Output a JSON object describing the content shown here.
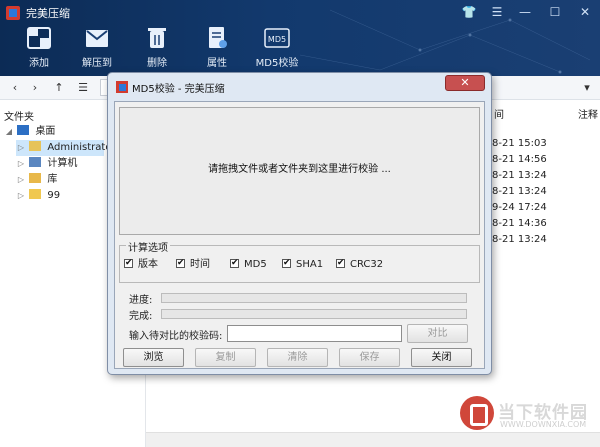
{
  "app": {
    "title": "完美压缩"
  },
  "window_controls": {
    "skin": "👕",
    "menu": "☰",
    "minimize": "—",
    "maximize": "☐",
    "close": "✕"
  },
  "toolbar": {
    "items": [
      {
        "label": "添加",
        "icon": "add-icon"
      },
      {
        "label": "解压到",
        "icon": "extract-icon"
      },
      {
        "label": "删除",
        "icon": "trash-icon"
      },
      {
        "label": "属性",
        "icon": "properties-icon"
      },
      {
        "label": "MD5校验",
        "icon": "md5-icon",
        "icon_text": "MD5"
      }
    ]
  },
  "nav": {
    "back": "‹",
    "forward": "›",
    "up": "↑",
    "list": "☰"
  },
  "tree": {
    "header": "文件夹",
    "items": [
      {
        "label": "桌面",
        "expanded": true
      },
      {
        "label": "Administrator",
        "selected": true
      },
      {
        "label": "计算机"
      },
      {
        "label": "库"
      },
      {
        "label": "99"
      }
    ]
  },
  "list": {
    "headers": {
      "modified": "间",
      "note": "注释"
    },
    "dates": [
      "8-21 15:03",
      "8-21 14:56",
      "8-21 13:24",
      "8-21 13:24",
      "9-24 17:24",
      "8-21 14:36",
      "8-21 13:24"
    ]
  },
  "watermark": {
    "text": "当下软件园",
    "url": "WWW.DOWNXIA.COM"
  },
  "dialog": {
    "title": "MD5校验 - 完美压缩",
    "close": "✕",
    "drop_message": "请拖拽文件或者文件夹到这里进行校验 ...",
    "options_title": "计算选项",
    "options": [
      {
        "label": "版本",
        "checked": true
      },
      {
        "label": "时间",
        "checked": true
      },
      {
        "label": "MD5",
        "checked": true
      },
      {
        "label": "SHA1",
        "checked": true
      },
      {
        "label": "CRC32",
        "checked": true
      }
    ],
    "progress_label": "进度:",
    "progress": 0,
    "done_label": "完成:",
    "done": 0,
    "hash_label": "输入待对比的校验码:",
    "hash_value": "",
    "compare_button": "对比",
    "buttons": {
      "browse": "浏览",
      "copy": "复制",
      "clear": "清除",
      "save": "保存",
      "close": "关闭"
    }
  },
  "colors": {
    "topbar": "#12396d",
    "dialog_frame": "#dfe8f3",
    "close_red": "#c75050",
    "selection": "#cde6fb"
  }
}
